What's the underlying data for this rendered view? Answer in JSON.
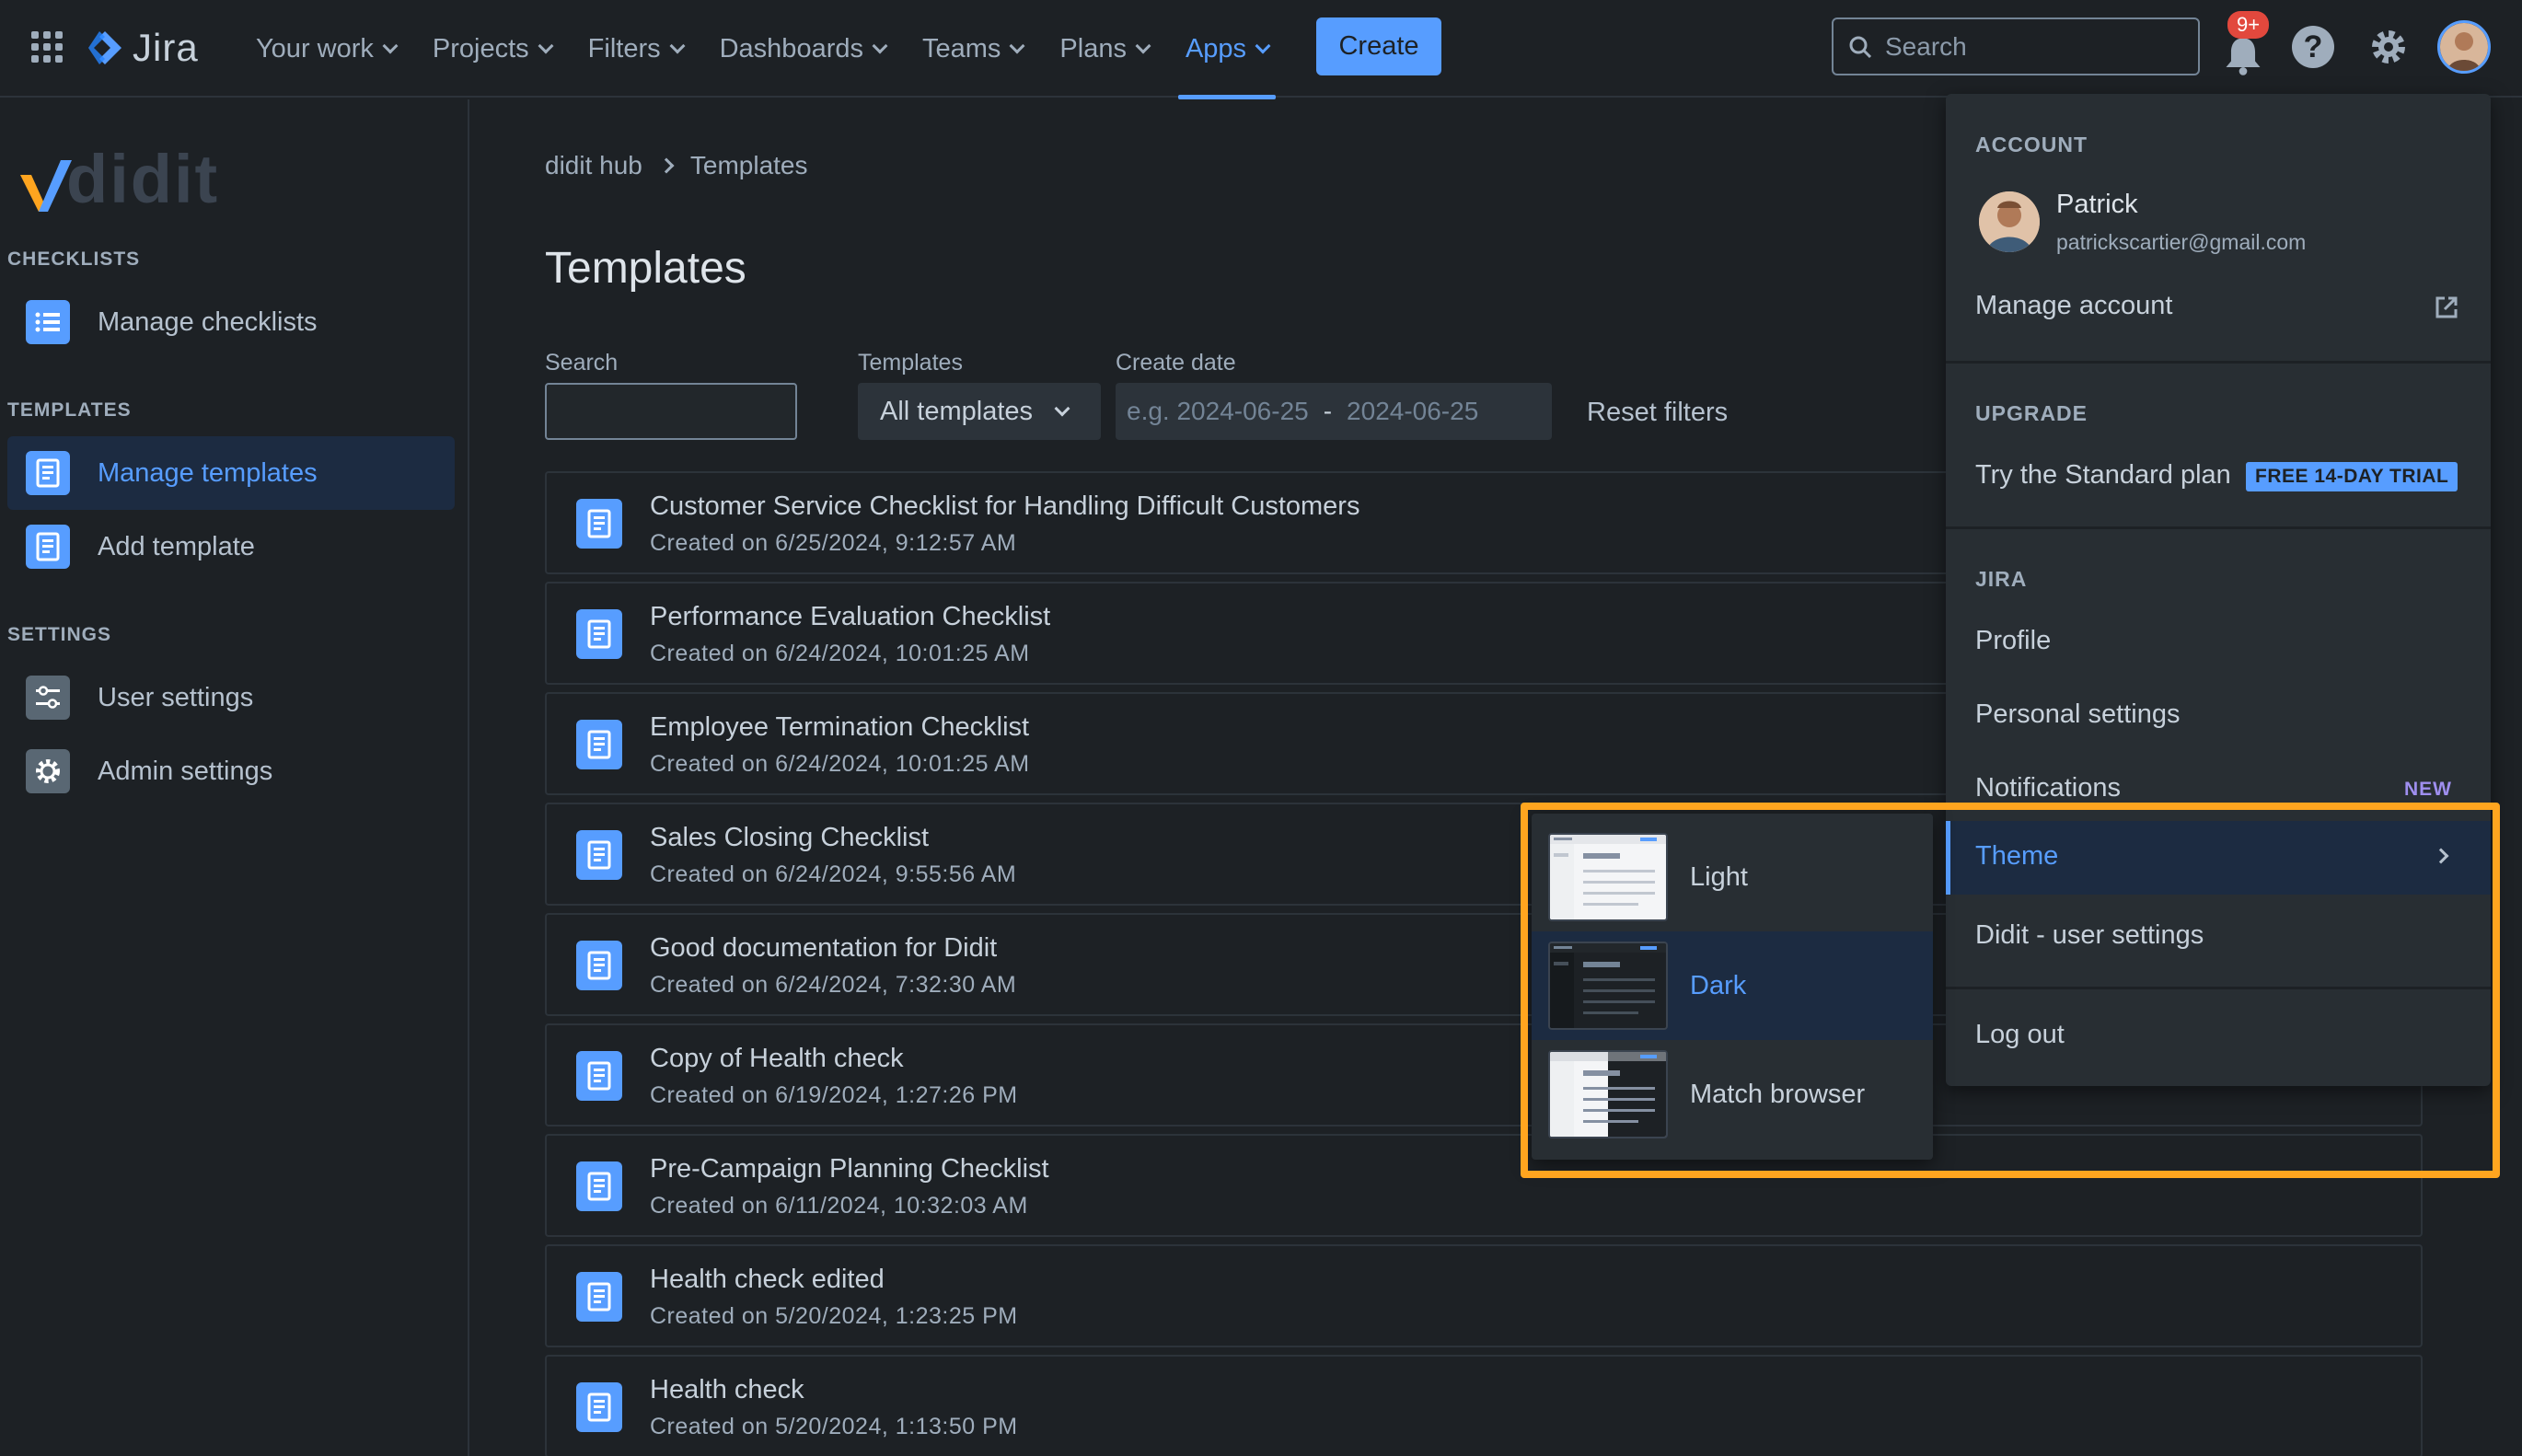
{
  "topnav": {
    "product": "Jira",
    "items": [
      {
        "label": "Your work",
        "active": false
      },
      {
        "label": "Projects",
        "active": false
      },
      {
        "label": "Filters",
        "active": false
      },
      {
        "label": "Dashboards",
        "active": false
      },
      {
        "label": "Teams",
        "active": false
      },
      {
        "label": "Plans",
        "active": false
      },
      {
        "label": "Apps",
        "active": true
      }
    ],
    "create_label": "Create",
    "search_placeholder": "Search",
    "notification_badge": "9+",
    "icons": [
      "app-switcher-icon",
      "bell-icon",
      "help-icon",
      "gear-icon"
    ]
  },
  "sidebar": {
    "logo_text": "didit",
    "sections": {
      "checklists": "CHECKLISTS",
      "templates": "TEMPLATES",
      "settings": "SETTINGS"
    },
    "items": {
      "manage_checklists": "Manage checklists",
      "manage_templates": "Manage templates",
      "add_template": "Add template",
      "user_settings": "User settings",
      "admin_settings": "Admin settings"
    }
  },
  "main": {
    "breadcrumb": {
      "root": "didit hub",
      "current": "Templates"
    },
    "title": "Templates",
    "filters": {
      "search_label": "Search",
      "templates_label": "Templates",
      "templates_value": "All templates",
      "date_label": "Create date",
      "date_from": "e.g. 2024-06-25",
      "date_sep": "-",
      "date_to": "2024-06-25",
      "reset_label": "Reset filters"
    },
    "templates": [
      {
        "title": "Customer Service Checklist for Handling Difficult Customers",
        "created": "Created on 6/25/2024, 9:12:57 AM"
      },
      {
        "title": "Performance Evaluation Checklist",
        "created": "Created on 6/24/2024, 10:01:25 AM"
      },
      {
        "title": "Employee Termination Checklist",
        "created": "Created on 6/24/2024, 10:01:25 AM"
      },
      {
        "title": "Sales Closing Checklist",
        "created": "Created on 6/24/2024, 9:55:56 AM"
      },
      {
        "title": "Good documentation for Didit",
        "created": "Created on 6/24/2024, 7:32:30 AM"
      },
      {
        "title": "Copy of Health check",
        "created": "Created on 6/19/2024, 1:27:26 PM"
      },
      {
        "title": "Pre-Campaign Planning Checklist",
        "created": "Created on 6/11/2024, 10:32:03 AM"
      },
      {
        "title": "Health check edited",
        "created": "Created on 5/20/2024, 1:23:25 PM"
      },
      {
        "title": "Health check",
        "created": "Created on 5/20/2024, 1:13:50 PM"
      }
    ]
  },
  "account_menu": {
    "account_section": "ACCOUNT",
    "user_name": "Patrick",
    "user_email": "patrickscartier@gmail.com",
    "manage_account": "Manage account",
    "upgrade_section": "UPGRADE",
    "try_plan": "Try the Standard plan",
    "trial_badge": "FREE 14-DAY TRIAL",
    "jira_section": "JIRA",
    "profile": "Profile",
    "personal_settings": "Personal settings",
    "notifications": "Notifications",
    "new_badge": "NEW",
    "theme": "Theme",
    "didit_settings": "Didit - user settings",
    "logout": "Log out"
  },
  "theme_menu": {
    "options": [
      {
        "label": "Light",
        "selected": false
      },
      {
        "label": "Dark",
        "selected": true
      },
      {
        "label": "Match browser",
        "selected": false
      }
    ]
  },
  "colors": {
    "accent": "#579dff",
    "highlight": "#ffa51f",
    "background": "#1d2125",
    "menu": "#282e33"
  }
}
